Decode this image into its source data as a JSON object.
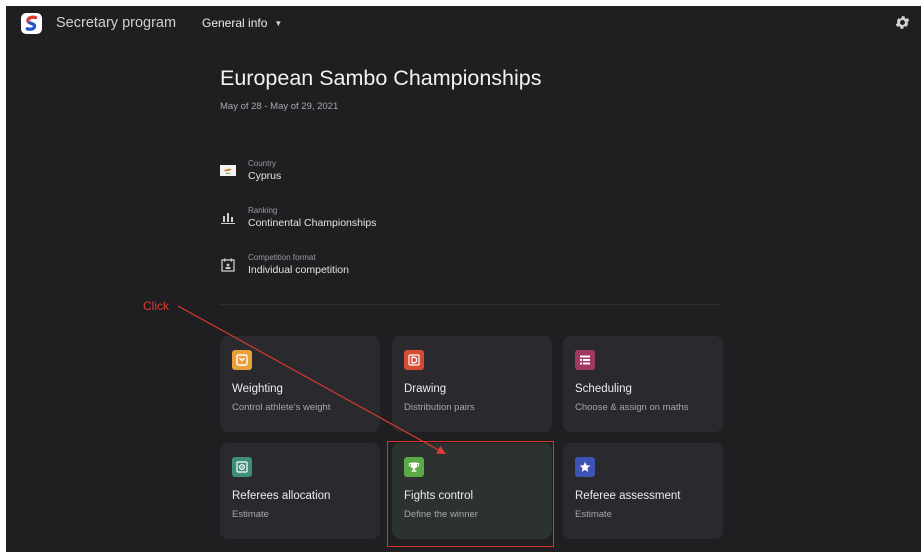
{
  "app": {
    "title": "Secretary program",
    "nav_dropdown_label": "General info",
    "colors": {
      "background": "#1f1f22",
      "card": "#2a2a2e",
      "accent_red": "#e13a30"
    }
  },
  "event": {
    "title": "European Sambo Championships",
    "dates": "May of 28 - May of 29, 2021",
    "info": [
      {
        "label": "Country",
        "value": "Cyprus",
        "icon": "cyprus-flag-icon"
      },
      {
        "label": "Ranking",
        "value": "Continental Championships",
        "icon": "bar-chart-icon"
      },
      {
        "label": "Competition format",
        "value": "Individual competition",
        "icon": "calendar-person-icon"
      }
    ]
  },
  "cards": [
    {
      "title": "Weighting",
      "subtitle": "Control athlete's weight",
      "icon": "scale-icon",
      "color": "#e9a03b"
    },
    {
      "title": "Drawing",
      "subtitle": "Distribution pairs",
      "icon": "letter-d-icon",
      "color": "#d64b34"
    },
    {
      "title": "Scheduling",
      "subtitle": "Choose & assign on maths",
      "icon": "list-icon",
      "color": "#a23764"
    },
    {
      "title": "Referees allocation",
      "subtitle": "Estimate",
      "icon": "target-icon",
      "color": "#3f8d7c"
    },
    {
      "title": "Fights control",
      "subtitle": "Define the winner",
      "icon": "trophy-icon",
      "color": "#5ca948"
    },
    {
      "title": "Referee assessment",
      "subtitle": "Estimate",
      "icon": "star-icon",
      "color": "#3e53b6"
    }
  ],
  "annotation": {
    "label": "Click",
    "target": "Fights control"
  }
}
